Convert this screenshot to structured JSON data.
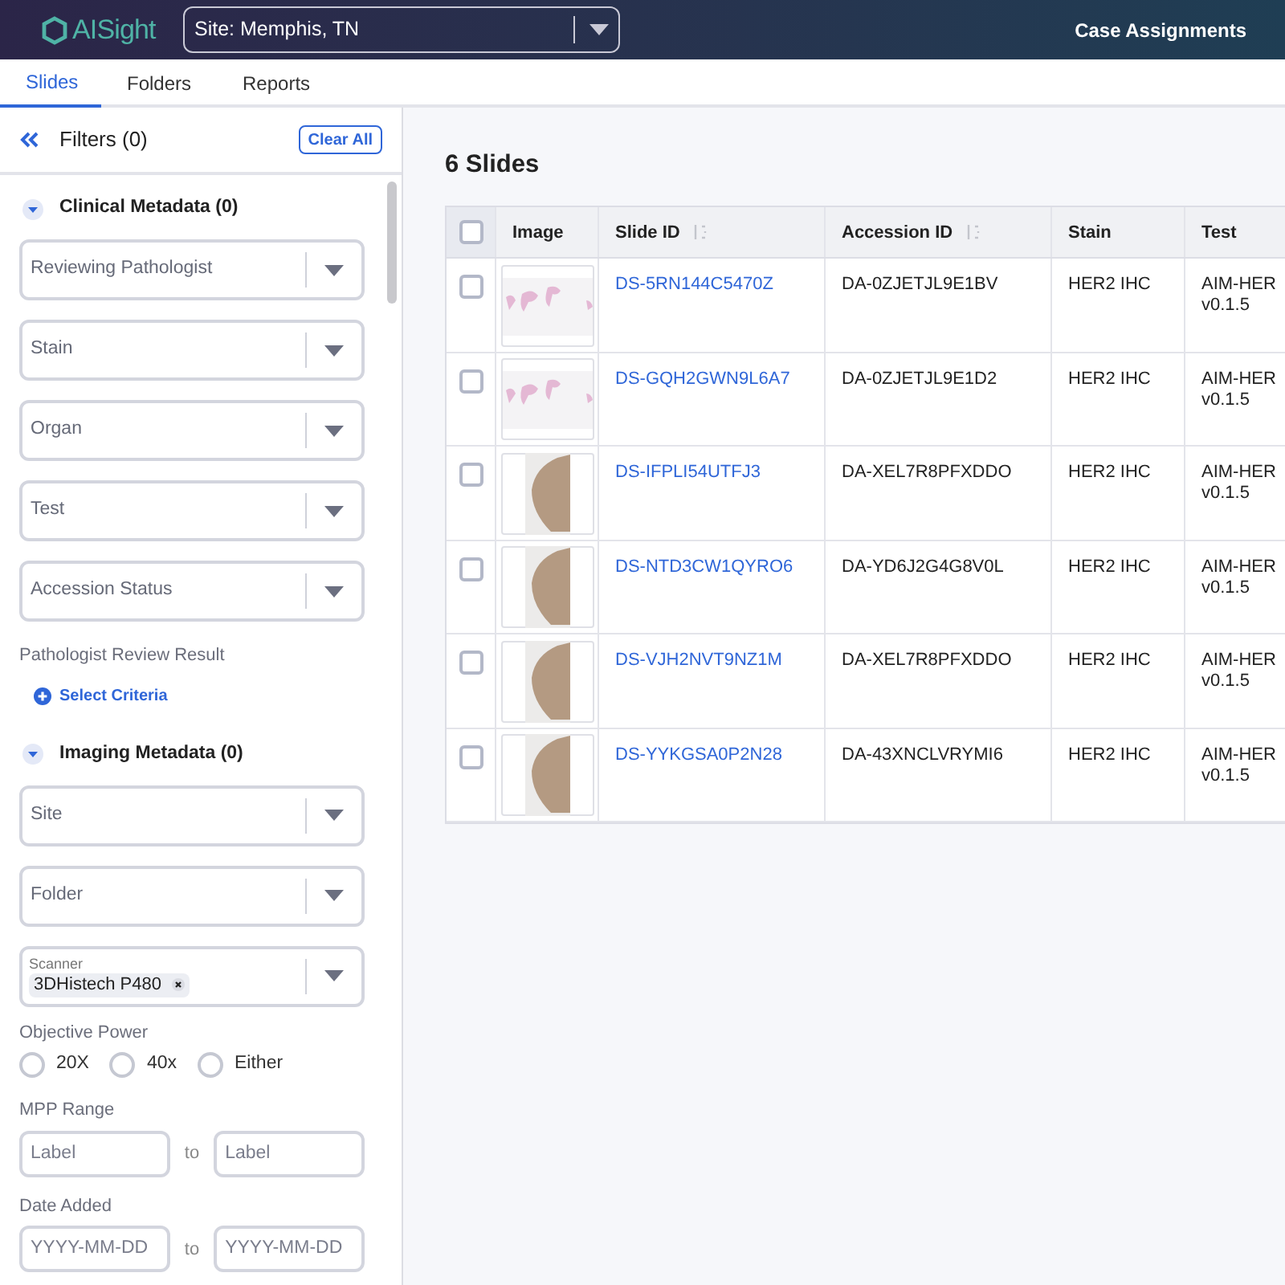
{
  "header": {
    "logo": "AISight",
    "site_select": "Site: Memphis, TN",
    "link": "Case Assignments"
  },
  "tabs": [
    {
      "label": "Slides",
      "selected": true
    },
    {
      "label": "Folders",
      "selected": false
    },
    {
      "label": "Reports",
      "selected": false
    }
  ],
  "filters": {
    "title": "Filters (0)",
    "clear_button": "Clear All",
    "sections": [
      {
        "title": "Clinical Metadata (0)",
        "expanded": true,
        "items": [
          {
            "kind": "select",
            "label": "Reviewing Pathologist"
          },
          {
            "kind": "select",
            "label": "Stain"
          },
          {
            "kind": "select",
            "label": "Organ"
          },
          {
            "kind": "select",
            "label": "Test"
          },
          {
            "kind": "select",
            "label": "Accession Status"
          },
          {
            "kind": "criteria",
            "label": "Pathologist Review Result",
            "action": "Select Criteria"
          }
        ]
      },
      {
        "title": "Imaging Metadata (0)",
        "expanded": true,
        "items": [
          {
            "kind": "select",
            "label": "Site"
          },
          {
            "kind": "select",
            "label": "Folder"
          },
          {
            "kind": "chips",
            "label": "Scanner",
            "chips": [
              "3DHistech P480"
            ]
          },
          {
            "kind": "radio",
            "label": "Objective Power",
            "options": [
              {
                "label": "20X",
                "selected": false
              },
              {
                "label": "40x",
                "selected": false
              },
              {
                "label": "Either",
                "selected": false
              }
            ]
          },
          {
            "kind": "range",
            "label": "MPP Range",
            "from": "Label",
            "separator": "to",
            "to": "Label"
          },
          {
            "kind": "range",
            "label": "Date Added",
            "from": "YYYY-MM-DD",
            "separator": "to",
            "to": "YYYY-MM-DD"
          }
        ]
      }
    ]
  },
  "results": {
    "title": "6 Slides",
    "select_all_checked": false,
    "columns": [
      {
        "label": "Image",
        "sortable": false
      },
      {
        "label": "Slide ID",
        "sortable": true
      },
      {
        "label": "Accession ID",
        "sortable": true
      },
      {
        "label": "Stain",
        "sortable": false
      },
      {
        "label": "Test",
        "sortable": false
      }
    ],
    "rows": [
      {
        "checked": false,
        "slide_id": "DS-5RN144C5470Z",
        "accession_id": "DA-0ZJETJL9E1BV",
        "stain": "HER2 IHC",
        "test": "AIM-HER v0.1.5"
      },
      {
        "checked": false,
        "slide_id": "DS-GQH2GWN9L6A7",
        "accession_id": "DA-0ZJETJL9E1D2",
        "stain": "HER2 IHC",
        "test": "AIM-HER v0.1.5"
      },
      {
        "checked": false,
        "slide_id": "DS-IFPLI54UTFJ3",
        "accession_id": "DA-XEL7R8PFXDDO",
        "stain": "HER2 IHC",
        "test": "AIM-HER v0.1.5"
      },
      {
        "checked": false,
        "slide_id": "DS-NTD3CW1QYRO6",
        "accession_id": "DA-YD6J2G4G8V0L",
        "stain": "HER2 IHC",
        "test": "AIM-HER v0.1.5"
      },
      {
        "checked": false,
        "slide_id": "DS-VJH2NVT9NZ1M",
        "accession_id": "DA-XEL7R8PFXDDO",
        "stain": "HER2 IHC",
        "test": "AIM-HER v0.1.5"
      },
      {
        "checked": false,
        "slide_id": "DS-YYKGSA0P2N28",
        "accession_id": "DA-43XNCLVRYMI6",
        "stain": "HER2 IHC",
        "test": "AIM-HER v0.1.5"
      }
    ]
  }
}
